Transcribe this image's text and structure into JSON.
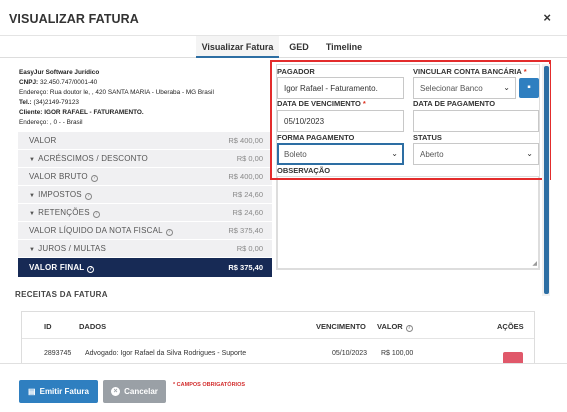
{
  "modal": {
    "title": "VISUALIZAR FATURA",
    "close_label": "×"
  },
  "tabs": [
    {
      "label": "Visualizar Fatura",
      "active": true
    },
    {
      "label": "GED",
      "active": false
    },
    {
      "label": "Timeline",
      "active": false
    }
  ],
  "company": {
    "name": "EasyJur Software Jurídico",
    "cnpj_label": "CNPJ:",
    "cnpj": "32.450.747/0001-40",
    "address_label": "Endereço:",
    "address": "Rua doutor le, , 420 SANTA MARIA - Uberaba - MG Brasil",
    "phone_label": "Tel.:",
    "phone": "(34)2149-79123",
    "client_label": "Cliente:",
    "client": "IGOR RAFAEL - FATURAMENTO.",
    "client_address_label": "Endereço:",
    "client_address": ", 0 - - Brasil"
  },
  "values": [
    {
      "label": "VALOR",
      "amount": "R$ 400,00",
      "caret": false,
      "help": false
    },
    {
      "label": "ACRÉSCIMOS / DESCONTO",
      "amount": "R$ 0,00",
      "caret": true,
      "help": false
    },
    {
      "label": "VALOR BRUTO",
      "amount": "R$ 400,00",
      "caret": false,
      "help": true
    },
    {
      "label": "IMPOSTOS",
      "amount": "R$ 24,60",
      "caret": true,
      "help": true
    },
    {
      "label": "RETENÇÕES",
      "amount": "R$ 24,60",
      "caret": true,
      "help": true
    },
    {
      "label": "VALOR LÍQUIDO DA NOTA FISCAL",
      "amount": "R$ 375,40",
      "caret": false,
      "help": true
    },
    {
      "label": "JUROS / MULTAS",
      "amount": "R$ 0,00",
      "caret": true,
      "help": false
    },
    {
      "label": "VALOR FINAL",
      "amount": "R$ 375,40",
      "caret": false,
      "help": true,
      "final": true
    }
  ],
  "form": {
    "pagador_label": "PAGADOR",
    "pagador_value": "Igor Rafael - Faturamento.",
    "vincular_label": "VINCULAR CONTA BANCÁRIA",
    "vincular_required": "*",
    "vincular_value": "Selecionar Banco",
    "vencimento_label": "DATA DE VENCIMENTO",
    "vencimento_required": "*",
    "vencimento_value": "05/10/2023",
    "pagamento_label": "DATA DE PAGAMENTO",
    "pagamento_value": "",
    "forma_label": "FORMA PAGAMENTO",
    "forma_value": "Boleto",
    "status_label": "STATUS",
    "status_value": "Aberto",
    "observacao_label": "OBSERVAÇÃO"
  },
  "receitas": {
    "title": "RECEITAS DA FATURA",
    "columns": [
      "ID",
      "DADOS",
      "VENCIMENTO",
      "VALOR",
      "AÇÕES"
    ],
    "rows": [
      {
        "id": "2893745",
        "dados": "Advogado: Igor Rafael da Silva Rodrigues - Suporte",
        "vencimento": "05/10/2023",
        "valor": "R$ 100,00"
      }
    ]
  },
  "footer": {
    "emit_label": "Emitir Fatura",
    "cancel_label": "Cancelar",
    "mandatory_note": "* CAMPOS OBRIGATÓRIOS"
  },
  "colors": {
    "primary": "#2f7fc0",
    "final_row": "#172a55",
    "highlight": "#e32c2c",
    "danger": "#e0586a"
  }
}
